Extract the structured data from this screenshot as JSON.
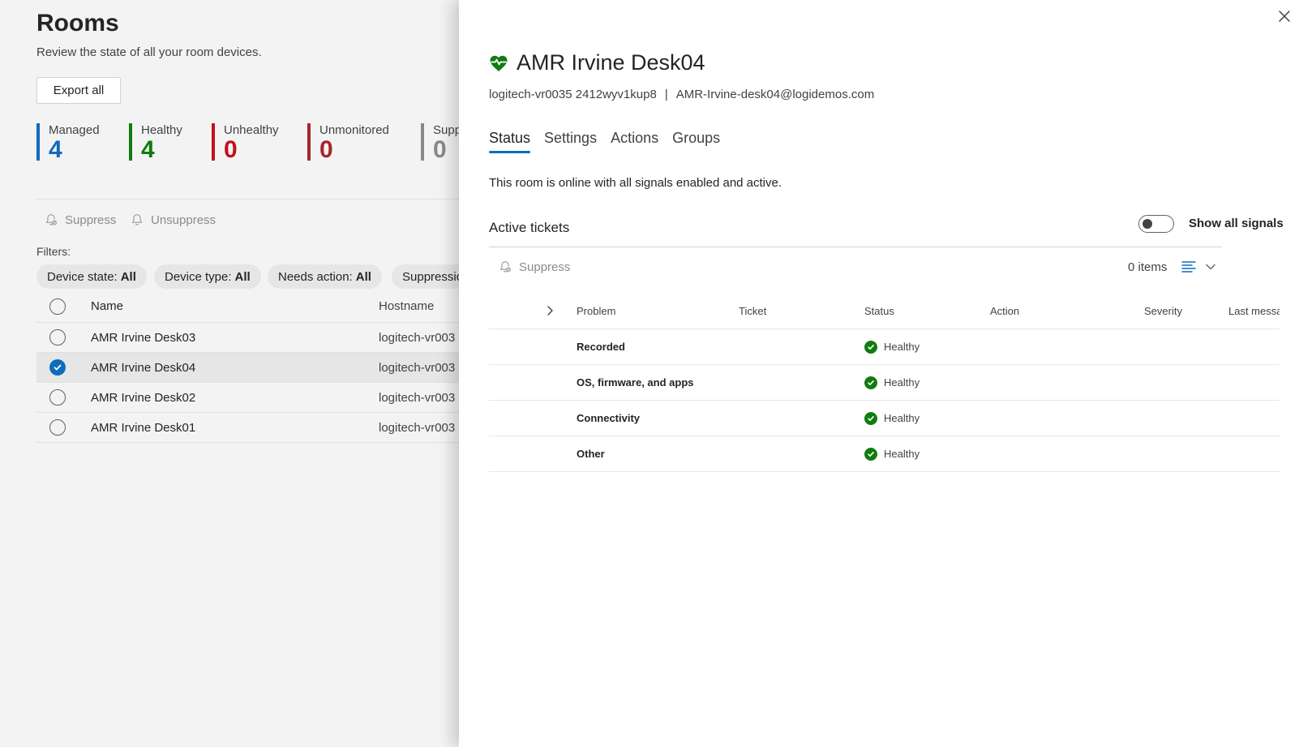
{
  "rooms_page": {
    "title": "Rooms",
    "subtitle": "Review the state of all your room devices.",
    "export_label": "Export all",
    "stats": {
      "managed": {
        "label": "Managed",
        "value": "4"
      },
      "healthy": {
        "label": "Healthy",
        "value": "4"
      },
      "unhealthy": {
        "label": "Unhealthy",
        "value": "0"
      },
      "unmonitored": {
        "label": "Unmonitored",
        "value": "0"
      },
      "suppressed": {
        "label": "Supp",
        "value": "0"
      }
    },
    "commands": {
      "suppress": "Suppress",
      "unsuppress": "Unsuppress"
    },
    "filters_label": "Filters:",
    "filters": {
      "device_state": {
        "label": "Device state:",
        "value": "All"
      },
      "device_type": {
        "label": "Device type:",
        "value": "All"
      },
      "needs_action": {
        "label": "Needs action:",
        "value": "All"
      },
      "suppression": {
        "label": "Suppressic"
      }
    },
    "table": {
      "columns": {
        "name": "Name",
        "hostname": "Hostname"
      },
      "rows": [
        {
          "name": "AMR Irvine Desk03",
          "hostname": "logitech-vr003"
        },
        {
          "name": "AMR Irvine Desk04",
          "hostname": "logitech-vr003"
        },
        {
          "name": "AMR Irvine Desk02",
          "hostname": "logitech-vr003"
        },
        {
          "name": "AMR Irvine Desk01",
          "hostname": "logitech-vr003"
        }
      ]
    }
  },
  "panel": {
    "title": "AMR Irvine Desk04",
    "device_id": "logitech-vr0035 2412wyv1kup8",
    "separator": "|",
    "email": "AMR-Irvine-desk04@logidemos.com",
    "tabs": [
      "Status",
      "Settings",
      "Actions",
      "Groups"
    ],
    "online_message": "This room is online with all signals enabled and active.",
    "active_tickets_title": "Active tickets",
    "show_all_signals_label": "Show all signals",
    "show_all_signals_on": false,
    "suppress_label": "Suppress",
    "items_count": "0 items",
    "table": {
      "columns": {
        "problem": "Problem",
        "ticket": "Ticket",
        "status": "Status",
        "action": "Action",
        "severity": "Severity",
        "last_message": "Last messa"
      },
      "rows": [
        {
          "problem": "Recorded",
          "status": "Healthy"
        },
        {
          "problem": "OS, firmware, and apps",
          "status": "Healthy"
        },
        {
          "problem": "Connectivity",
          "status": "Healthy"
        },
        {
          "problem": "Other",
          "status": "Healthy"
        }
      ]
    }
  },
  "colors": {
    "accent": "#0f6cbd",
    "healthy": "#107c10",
    "unhealthy": "#c50f1f",
    "unmonitored": "#a4262c",
    "suppressed": "#8a8886"
  },
  "icons": [
    "heart-pulse-icon",
    "close-icon",
    "bell-suppress-icon",
    "bell-icon",
    "chevron-right-icon",
    "checkmark-circle-icon",
    "list-view-icon",
    "chevron-down-icon"
  ]
}
